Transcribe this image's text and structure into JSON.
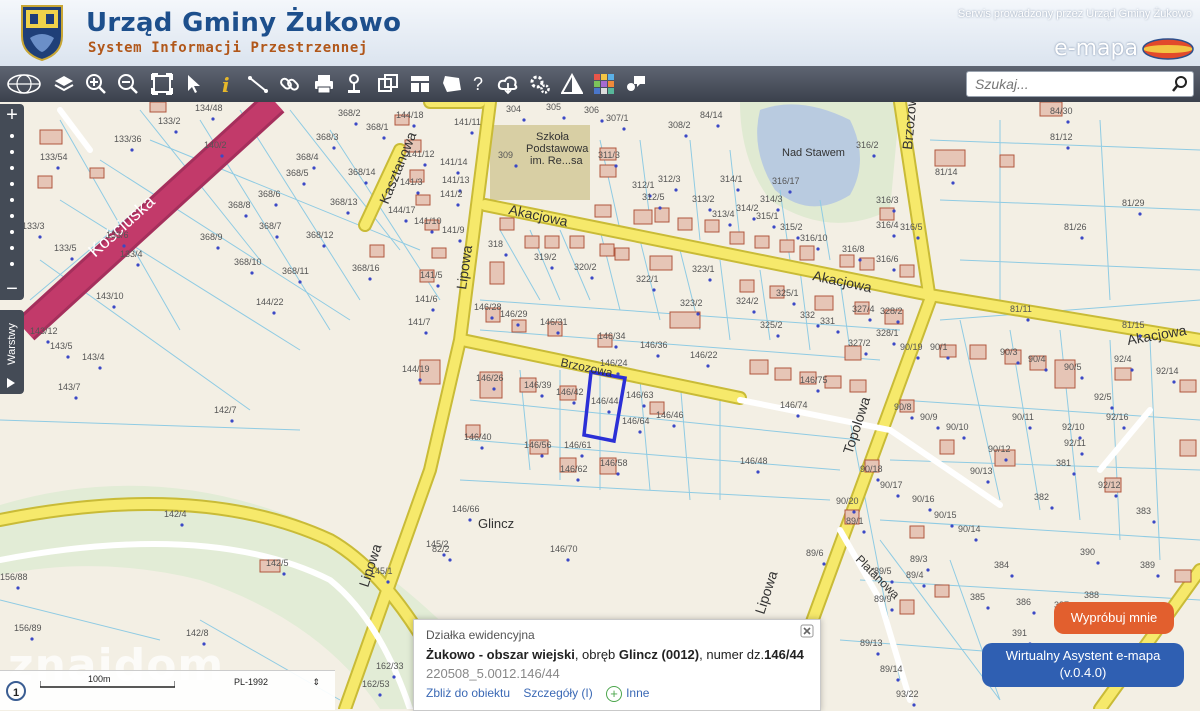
{
  "header": {
    "title": "Urząd Gminy Żukowo",
    "subtitle": "System Informacji Przestrzennej",
    "service_text": "Serwis prowadzony przez Urząd Gminy Żukowo",
    "brand": "e-mapa"
  },
  "toolbar": {
    "tools": [
      "globe-icon",
      "layers-icon",
      "zoom-in-icon",
      "zoom-out-icon",
      "zoom-extent-icon",
      "pointer-icon",
      "info-icon",
      "measure-line-icon",
      "link-icon",
      "print-icon",
      "pin-icon",
      "copy-icon",
      "layout-icon",
      "shape-icon",
      "help-icon",
      "cloud-icon",
      "settings-icon",
      "warning-icon",
      "legend-icon",
      "chat-icon"
    ],
    "help_symbol": "?"
  },
  "search": {
    "placeholder": "Szukaj..."
  },
  "sidebar": {
    "layers_label": "Warstwy",
    "zoom_in": "+",
    "zoom_out": "−"
  },
  "map": {
    "colors": {
      "road_fill": "#f6e96b",
      "road_edge": "#c9bb37",
      "main_road": "#c23a6a",
      "parcel_line": "#7ac3df",
      "building": "#e6c5b6",
      "building_edge": "#b0573e",
      "highlight": "#2b2fd6",
      "water": "#b9cbe0",
      "school": "#d8cfa4"
    },
    "streets": [
      "Kościuska",
      "Akacjowa",
      "Akacjowa",
      "Akacjowa",
      "Lipowa",
      "Lipowa",
      "Kasztanowa",
      "Brzozowa",
      "Topolowa",
      "Platanowa",
      "Lipowa",
      "Brzozowa"
    ],
    "places": [
      "Glincz",
      "Nad Stawem",
      "Szkoła",
      "Podstawowa",
      "im. Re...sa"
    ],
    "parcels": [
      "304",
      "305",
      "306",
      "307/1",
      "308/2",
      "84/14",
      "134/48",
      "133/2",
      "133/36",
      "133/54",
      "140/2",
      "368/2",
      "368/1",
      "368/3",
      "368/4",
      "368/5",
      "368/6",
      "368/7",
      "368/8",
      "368/9",
      "368/10",
      "368/11",
      "368/12",
      "368/13",
      "368/14",
      "368/16",
      "144/18",
      "144/17",
      "141/11",
      "141/12",
      "141/13",
      "141/14",
      "141/10",
      "141/9",
      "141/7",
      "141/6",
      "141/5",
      "141/2",
      "141/3",
      "144/22",
      "143/10",
      "143/12",
      "143/5",
      "143/4",
      "143/7",
      "133/5",
      "133/6",
      "133/4",
      "133/3",
      "309",
      "311/3",
      "312/1",
      "312/3",
      "312/5",
      "313/2",
      "313/4",
      "314/1",
      "314/2",
      "314/3",
      "315/1",
      "315/2",
      "316/2",
      "316/3",
      "316/4",
      "316/5",
      "316/6",
      "316/8",
      "316/10",
      "316/17",
      "81/14",
      "81/12",
      "81/29",
      "81/26",
      "318",
      "319/2",
      "320/2",
      "322/1",
      "323/1",
      "323/2",
      "324/2",
      "325/1",
      "325/2",
      "327/4",
      "328/1",
      "328/2",
      "332",
      "331",
      "327/2",
      "144/19",
      "146/28",
      "146/29",
      "146/31",
      "146/34",
      "146/36",
      "146/24",
      "146/22",
      "146/26",
      "146/39",
      "146/42",
      "146/44",
      "146/63",
      "146/64",
      "146/46",
      "146/40",
      "146/56",
      "146/61",
      "146/62",
      "146/58",
      "146/74",
      "146/75",
      "146/48",
      "146/66",
      "146/70",
      "142/7",
      "142/4",
      "142/5",
      "142/8",
      "145/1",
      "145/2",
      "156/89",
      "156/88",
      "162/53",
      "162/33",
      "90/1",
      "90/3",
      "90/4",
      "90/5",
      "90/8",
      "90/9",
      "90/10",
      "90/11",
      "90/12",
      "90/13",
      "90/14",
      "90/15",
      "90/16",
      "90/17",
      "90/18",
      "90/19",
      "90/20",
      "92/4",
      "92/5",
      "92/12",
      "92/14",
      "92/16",
      "92/11",
      "92/10",
      "81/11",
      "81/15",
      "381",
      "382",
      "383",
      "384",
      "385",
      "386",
      "387",
      "388",
      "389",
      "390",
      "391",
      "89/1",
      "89/3",
      "89/4",
      "89/5",
      "89/6",
      "89/9",
      "89/13",
      "89/14",
      "93/22",
      "84/30",
      "82/2"
    ],
    "parcel_highlight": "146/44"
  },
  "status": {
    "page": "1",
    "scale": "100m",
    "crs": "PL-1992",
    "watermark": "znajdom"
  },
  "popup": {
    "header": "Działka ewidencyjna",
    "place": "Żukowo - obszar wiejski",
    "sep1": ", obręb ",
    "obreb": "Glincz (0012)",
    "sep2": ", numer dz.",
    "number": "146/44",
    "id": "220508_5.0012.146/44",
    "action_zoom": "Zbliż do obiektu",
    "action_details": "Szczegóły (I)",
    "action_other": "Inne"
  },
  "buttons": {
    "try_label": "Wypróbuj mnie",
    "assistant_line1": "Wirtualny Asystent e-mapa",
    "assistant_line2": "(v.0.4.0)"
  }
}
